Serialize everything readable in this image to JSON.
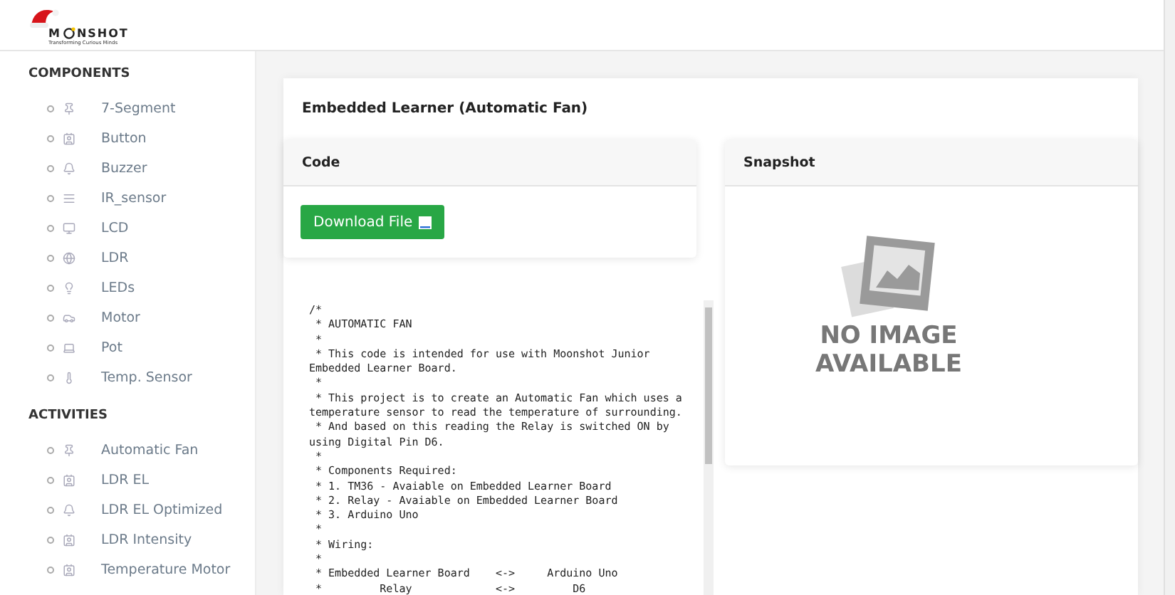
{
  "brand": {
    "lead": "M",
    "tail": "NSHOT",
    "tagline": "Transforming Curious Minds"
  },
  "sidebar": {
    "sections": [
      {
        "title": "COMPONENTS",
        "items": [
          {
            "label": "7-Segment",
            "kind": "pin"
          },
          {
            "label": "Button",
            "kind": "badge"
          },
          {
            "label": "Buzzer",
            "kind": "bell"
          },
          {
            "label": "IR_sensor",
            "kind": "bars"
          },
          {
            "label": "LCD",
            "kind": "monitor"
          },
          {
            "label": "LDR",
            "kind": "globe"
          },
          {
            "label": "LEDs",
            "kind": "bulb"
          },
          {
            "label": "Motor",
            "kind": "car"
          },
          {
            "label": "Pot",
            "kind": "laptop"
          },
          {
            "label": "Temp. Sensor",
            "kind": "thermometer"
          }
        ]
      },
      {
        "title": "ACTIVITIES",
        "items": [
          {
            "label": "Automatic Fan",
            "kind": "pin"
          },
          {
            "label": "LDR EL",
            "kind": "badge"
          },
          {
            "label": "LDR EL Optimized",
            "kind": "bell"
          },
          {
            "label": "LDR Intensity",
            "kind": "badge"
          },
          {
            "label": "Temperature Motor",
            "kind": "badge"
          }
        ]
      }
    ]
  },
  "page_title": "Embedded Learner (Automatic Fan)",
  "code_card": {
    "title": "Code",
    "button": "Download File"
  },
  "code": "/*\n * AUTOMATIC FAN\n *\n * This code is intended for use with Moonshot Junior\nEmbedded Learner Board.\n *\n * This project is to create an Automatic Fan which uses a\ntemperature sensor to read the temperature of surrounding.\n * And based on this reading the Relay is switched ON by\nusing Digital Pin D6.\n *\n * Components Required:\n * 1. TM36 - Avaiable on Embedded Learner Board\n * 2. Relay - Avaiable on Embedded Learner Board\n * 3. Arduino Uno\n *\n * Wiring:\n *\n * Embedded Learner Board    <->     Arduino Uno\n *         Relay             <->         D6",
  "snapshot_card": {
    "title": "Snapshot",
    "placeholder_lines": [
      "NO IMAGE",
      "AVAILABLE"
    ]
  }
}
